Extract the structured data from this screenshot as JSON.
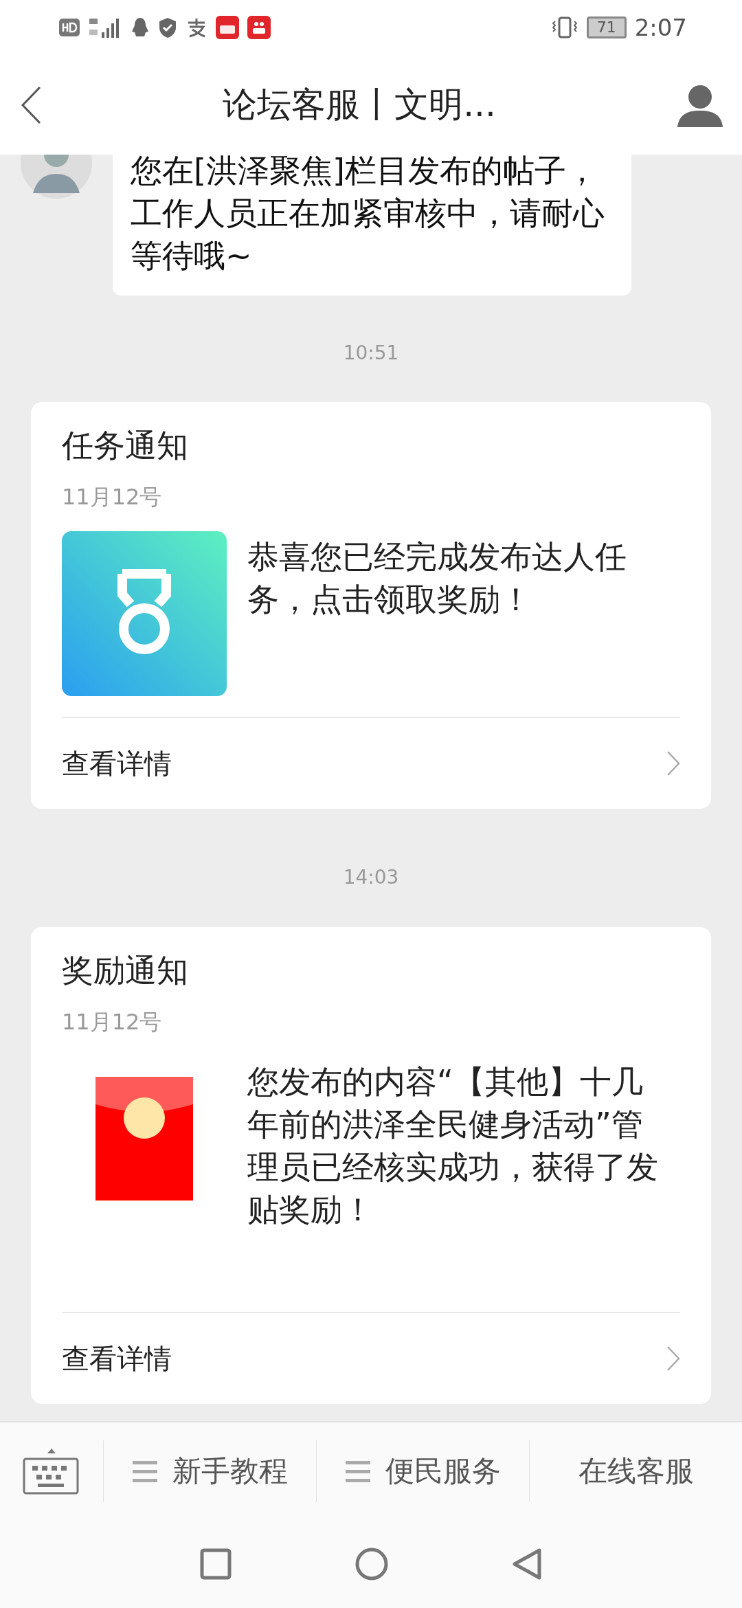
{
  "status_bar": {
    "battery": "71",
    "time": "2:07"
  },
  "header": {
    "title": "论坛客服丨文明..."
  },
  "messages": [
    {
      "kind": "bubble",
      "text": "您在[洪泽聚焦]栏目发布的帖子，工作人员正在加紧审核中，请耐心等待哦~"
    },
    {
      "kind": "time",
      "text": "10:51"
    },
    {
      "kind": "card",
      "title": "任务通知",
      "date": "11月12号",
      "text": "恭喜您已经完成发布达人任务，点击领取奖励！",
      "link": "查看详情"
    },
    {
      "kind": "time",
      "text": "14:03"
    },
    {
      "kind": "card",
      "title": "奖励通知",
      "date": "11月12号",
      "text": "您发布的内容“【其他】十几年前的洪泽全民健身活动”管理员已经核实成功，获得了发贴奖励！",
      "link": "查看详情"
    }
  ],
  "bottom_menu": [
    {
      "kind": "keyboard"
    },
    {
      "kind": "menu",
      "label": "新手教程"
    },
    {
      "kind": "menu",
      "label": "便民服务"
    },
    {
      "kind": "plain",
      "label": "在线客服"
    }
  ]
}
